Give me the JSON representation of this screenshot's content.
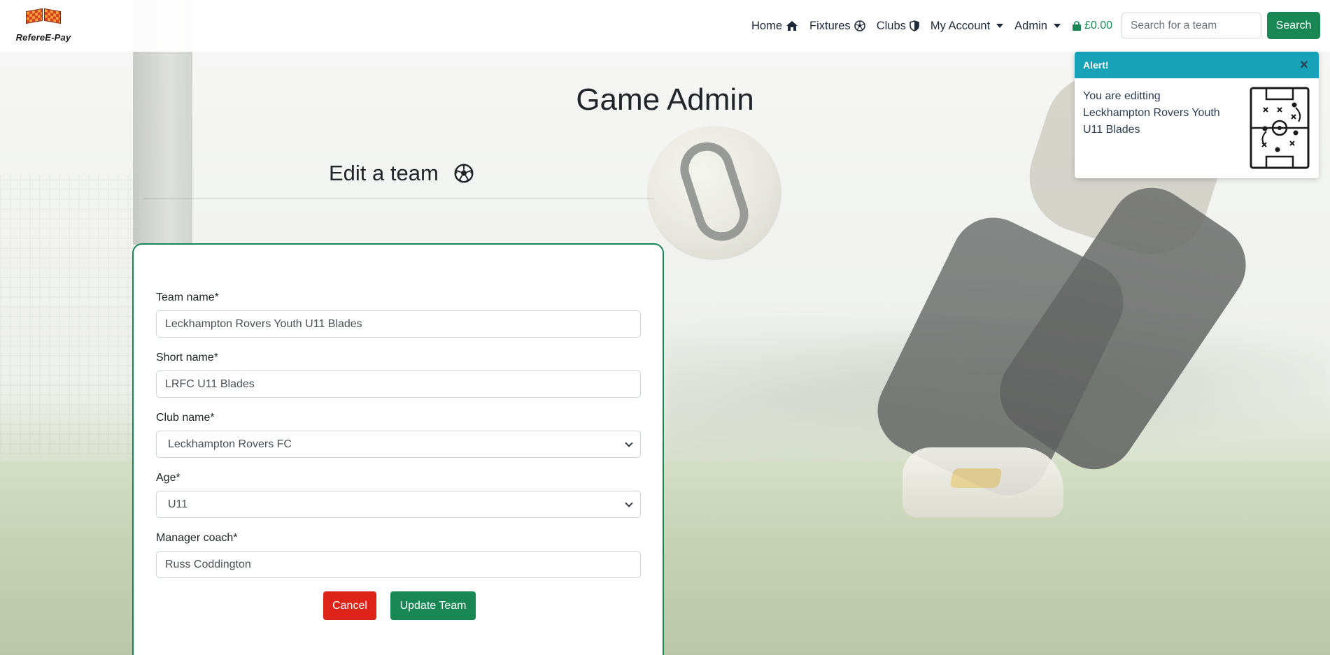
{
  "brand": {
    "name": "RefereE-Pay"
  },
  "nav": {
    "items": [
      {
        "label": "Home",
        "icon": "home-icon",
        "dropdown": false
      },
      {
        "label": "Fixtures",
        "icon": "soccer-ball-icon",
        "dropdown": false
      },
      {
        "label": "Clubs",
        "icon": "shield-icon",
        "dropdown": false
      },
      {
        "label": "My Account",
        "icon": "",
        "dropdown": true
      },
      {
        "label": "Admin",
        "icon": "",
        "dropdown": true
      }
    ],
    "cart_total": "£0.00",
    "search_placeholder": "Search for a team",
    "search_button": "Search"
  },
  "page": {
    "title": "Game Admin",
    "section_title": "Edit a team"
  },
  "form": {
    "team_name": {
      "label": "Team name*",
      "value": "Leckhampton Rovers Youth U11 Blades"
    },
    "short_name": {
      "label": "Short name*",
      "value": "LRFC U11 Blades"
    },
    "club_name": {
      "label": "Club name*",
      "value": "Leckhampton Rovers FC"
    },
    "age": {
      "label": "Age*",
      "value": "U11"
    },
    "manager_coach": {
      "label": "Manager coach*",
      "value": "Russ Coddington"
    },
    "cancel_label": "Cancel",
    "submit_label": "Update Team"
  },
  "toast": {
    "title": "Alert!",
    "message": "You are editting Leckhampton Rovers Youth U11 Blades",
    "close_symbol": "×"
  },
  "colors": {
    "primary_green": "#198754",
    "danger_red": "#dc2419",
    "info_teal": "#17a2b8",
    "nav_text": "#1e2a3a"
  }
}
